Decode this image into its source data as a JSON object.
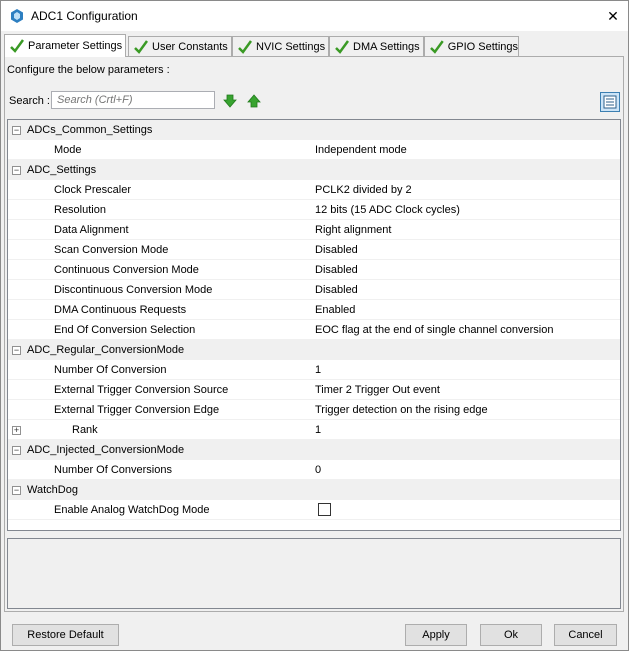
{
  "window": {
    "title": "ADC1 Configuration",
    "close_glyph": "✕"
  },
  "tabs": [
    {
      "label": "Parameter Settings"
    },
    {
      "label": "User Constants"
    },
    {
      "label": "NVIC Settings"
    },
    {
      "label": "DMA Settings"
    },
    {
      "label": "GPIO Settings"
    }
  ],
  "pane": {
    "caption": "Configure the below parameters :",
    "search_label": "Search :",
    "search_placeholder": "Search (Crtl+F)"
  },
  "colors": {
    "accent": "#3c7fb1",
    "check_green": "#3a9a25",
    "arrow_green": "#37a32f"
  },
  "icons": {
    "app": "chip-icon",
    "tab_check": "checkmark-icon",
    "down": "arrow-down-icon",
    "up": "arrow-up-icon",
    "view": "list-view-icon"
  },
  "groups": {
    "common": {
      "title": "ADCs_Common_Settings",
      "mode_label": "Mode",
      "mode_value": "Independent mode"
    },
    "adc": {
      "title": "ADC_Settings",
      "rows": [
        {
          "label": "Clock Prescaler",
          "value": "PCLK2 divided by 2"
        },
        {
          "label": "Resolution",
          "value": "12 bits (15 ADC Clock cycles)"
        },
        {
          "label": "Data Alignment",
          "value": "Right alignment"
        },
        {
          "label": "Scan Conversion Mode",
          "value": "Disabled"
        },
        {
          "label": "Continuous Conversion Mode",
          "value": "Disabled"
        },
        {
          "label": "Discontinuous Conversion Mode",
          "value": "Disabled"
        },
        {
          "label": "DMA Continuous Requests",
          "value": "Enabled"
        },
        {
          "label": "End Of Conversion Selection",
          "value": "EOC flag at the end of single channel conversion"
        }
      ]
    },
    "regular": {
      "title": "ADC_Regular_ConversionMode",
      "rows": [
        {
          "label": "Number Of Conversion",
          "value": "1"
        },
        {
          "label": "External Trigger Conversion Source",
          "value": "Timer 2 Trigger Out event"
        },
        {
          "label": "External Trigger Conversion Edge",
          "value": "Trigger detection on the rising edge"
        }
      ],
      "rank": {
        "label": "Rank",
        "value": "1"
      }
    },
    "injected": {
      "title": "ADC_Injected_ConversionMode",
      "conv_label": "Number Of Conversions",
      "conv_value": "0"
    },
    "watchdog": {
      "title": "WatchDog",
      "enable_label": "Enable Analog WatchDog Mode",
      "enabled": false
    }
  },
  "buttons": {
    "restore": "Restore Default",
    "apply": "Apply",
    "ok": "Ok",
    "cancel": "Cancel"
  }
}
